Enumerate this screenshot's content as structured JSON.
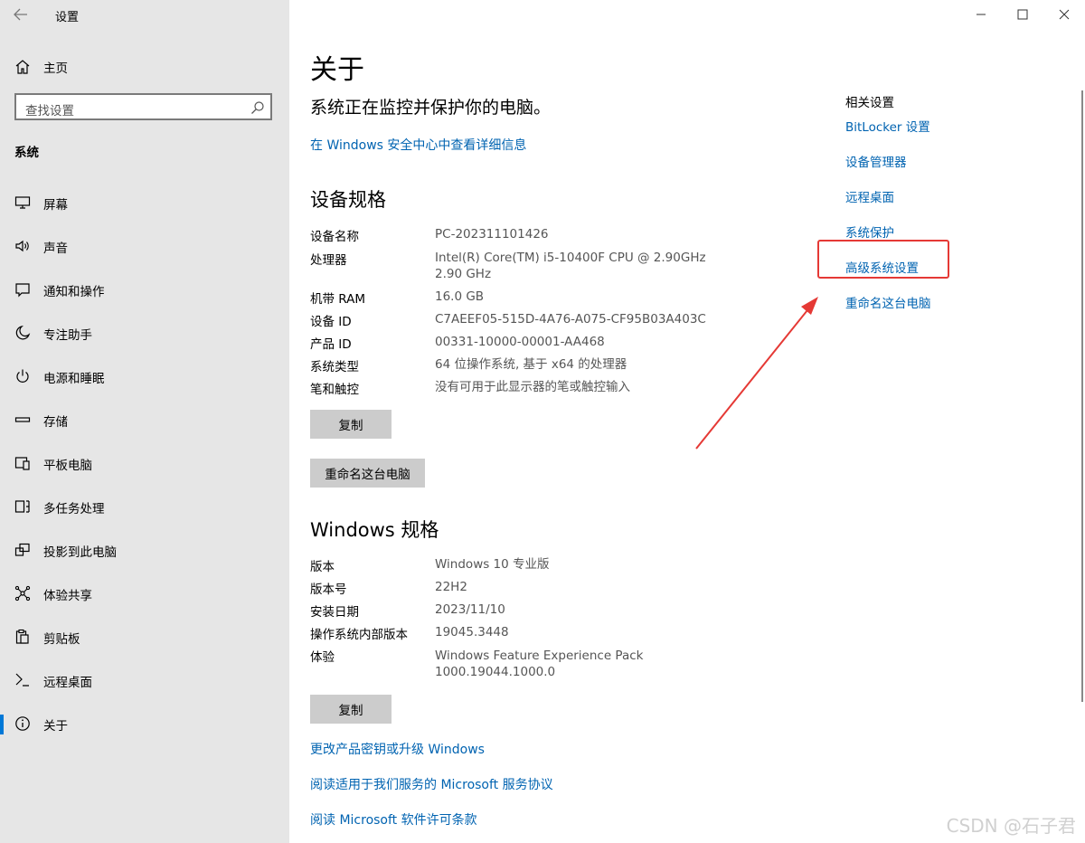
{
  "window": {
    "title": "设置"
  },
  "sidebar": {
    "home_label": "主页",
    "search_placeholder": "查找设置",
    "section": "系统",
    "items": [
      {
        "label": "屏幕",
        "icon": "monitor-icon"
      },
      {
        "label": "声音",
        "icon": "speaker-icon"
      },
      {
        "label": "通知和操作",
        "icon": "notification-icon"
      },
      {
        "label": "专注助手",
        "icon": "moon-icon"
      },
      {
        "label": "电源和睡眠",
        "icon": "power-icon"
      },
      {
        "label": "存储",
        "icon": "storage-icon"
      },
      {
        "label": "平板电脑",
        "icon": "tablet-icon"
      },
      {
        "label": "多任务处理",
        "icon": "multitask-icon"
      },
      {
        "label": "投影到此电脑",
        "icon": "project-icon"
      },
      {
        "label": "体验共享",
        "icon": "share-icon"
      },
      {
        "label": "剪贴板",
        "icon": "clipboard-icon"
      },
      {
        "label": "远程桌面",
        "icon": "remote-icon"
      },
      {
        "label": "关于",
        "icon": "info-icon",
        "active": true
      }
    ]
  },
  "main": {
    "title": "关于",
    "protect_text": "系统正在监控并保护你的电脑。",
    "security_link": "在 Windows 安全中心中查看详细信息",
    "device_spec": {
      "heading": "设备规格",
      "rows": [
        {
          "label": "设备名称",
          "value": "PC-202311101426"
        },
        {
          "label": "处理器",
          "value": "Intel(R) Core(TM) i5-10400F CPU @ 2.90GHz   2.90 GHz"
        },
        {
          "label": "机带 RAM",
          "value": "16.0 GB"
        },
        {
          "label": "设备 ID",
          "value": "C7AEEF05-515D-4A76-A075-CF95B03A403C"
        },
        {
          "label": "产品 ID",
          "value": "00331-10000-00001-AA468"
        },
        {
          "label": "系统类型",
          "value": "64 位操作系统, 基于 x64 的处理器"
        },
        {
          "label": "笔和触控",
          "value": "没有可用于此显示器的笔或触控输入"
        }
      ],
      "copy_button": "复制",
      "rename_button": "重命名这台电脑"
    },
    "windows_spec": {
      "heading": "Windows 规格",
      "rows": [
        {
          "label": "版本",
          "value": "Windows 10 专业版"
        },
        {
          "label": "版本号",
          "value": "22H2"
        },
        {
          "label": "安装日期",
          "value": "2023/11/10"
        },
        {
          "label": "操作系统内部版本",
          "value": "19045.3448"
        },
        {
          "label": "体验",
          "value": "Windows Feature Experience Pack 1000.19044.1000.0"
        }
      ],
      "copy_button": "复制"
    },
    "links": [
      "更改产品密钥或升级 Windows",
      "阅读适用于我们服务的 Microsoft 服务协议",
      "阅读 Microsoft 软件许可条款"
    ]
  },
  "related": {
    "title": "相关设置",
    "links": [
      "BitLocker 设置",
      "设备管理器",
      "远程桌面",
      "系统保护",
      "高级系统设置",
      "重命名这台电脑"
    ]
  },
  "annotation": {
    "highlight_color": "#e53935"
  },
  "watermark": "CSDN @石子君",
  "colors": {
    "sidebar_bg": "#e6e6e6",
    "link": "#0063b1",
    "accent": "#0078d7",
    "button_bg": "#cccccc"
  }
}
